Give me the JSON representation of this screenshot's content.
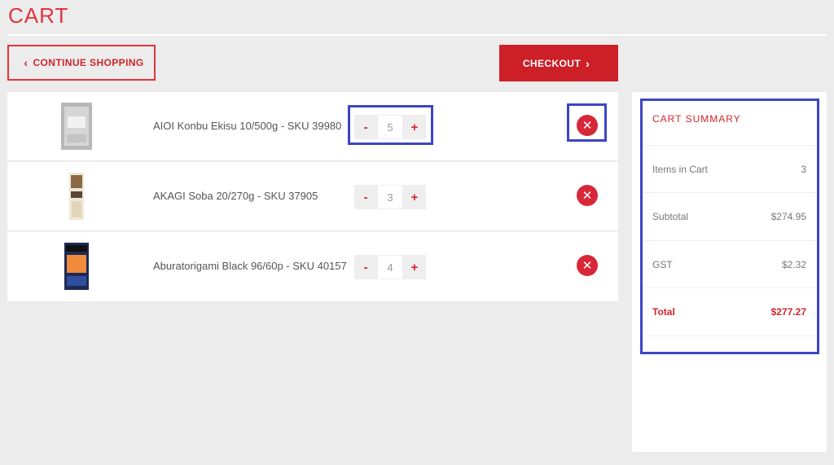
{
  "page": {
    "title": "CART"
  },
  "actions": {
    "continue_label": "CONTINUE SHOPPING",
    "checkout_label": "CHECKOUT"
  },
  "cart": {
    "items": [
      {
        "name": "AIOI Konbu Ekisu 10/500g - SKU 39980",
        "qty": "5",
        "minus": "-",
        "plus": "+"
      },
      {
        "name": "AKAGI Soba 20/270g - SKU 37905",
        "qty": "3",
        "minus": "-",
        "plus": "+"
      },
      {
        "name": "Aburatorigami Black 96/60p - SKU 40157",
        "qty": "4",
        "minus": "-",
        "plus": "+"
      }
    ]
  },
  "summary": {
    "title": "CART SUMMARY",
    "items_label": "Items in Cart",
    "items_value": "3",
    "subtotal_label": "Subtotal",
    "subtotal_value": "$274.95",
    "gst_label": "GST",
    "gst_value": "$2.32",
    "total_label": "Total",
    "total_value": "$277.27"
  },
  "colors": {
    "accent": "#cc1f27",
    "highlight": "#3c45c4",
    "background": "#ececec"
  }
}
